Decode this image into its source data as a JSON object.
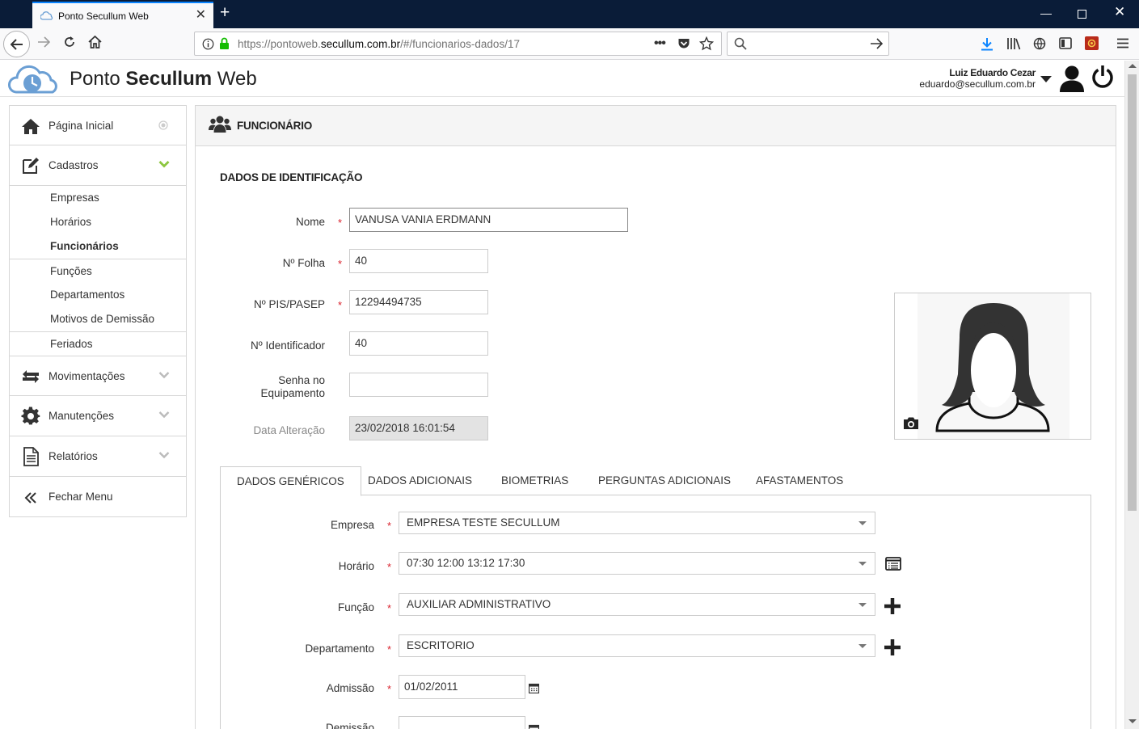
{
  "browser": {
    "tab_title": "Ponto Secullum Web",
    "url_prefix": "https://pontoweb.",
    "url_domain": "secullum.com.br",
    "url_path": "/#/funcionarios-dados/17"
  },
  "app": {
    "title_part1": "Ponto ",
    "title_part2": "Secullum",
    "title_part3": " Web",
    "user_name": "Luiz Eduardo Cezar",
    "user_email": "eduardo@secullum.com.br"
  },
  "sidebar": {
    "home": "Página Inicial",
    "cadastros": "Cadastros",
    "cadastros_items": [
      "Empresas",
      "Horários",
      "Funcionários",
      "Funções",
      "Departamentos",
      "Motivos de Demissão",
      "Feriados"
    ],
    "movimentacoes": "Movimentações",
    "manutencoes": "Manutenções",
    "relatorios": "Relatórios",
    "fechar": "Fechar Menu"
  },
  "panel": {
    "title": "FUNCIONÁRIO",
    "section": "DADOS DE IDENTIFICAÇÃO"
  },
  "form": {
    "nome_label": "Nome",
    "nome_value": "VANUSA VANIA ERDMANN",
    "folha_label": "Nº Folha",
    "folha_value": "40",
    "pis_label": "Nº PIS/PASEP",
    "pis_value": "12294494735",
    "ident_label": "Nº Identificador",
    "ident_value": "40",
    "senha_label_1": "Senha no",
    "senha_label_2": "Equipamento",
    "senha_value": "",
    "data_label": "Data Alteração",
    "data_value": "23/02/2018 16:01:54"
  },
  "tabs": [
    "DADOS GENÉRICOS",
    "DADOS ADICIONAIS",
    "BIOMETRIAS",
    "PERGUNTAS ADICIONAIS",
    "AFASTAMENTOS"
  ],
  "generic": {
    "empresa_label": "Empresa",
    "empresa_value": "EMPRESA TESTE SECULLUM",
    "horario_label": "Horário",
    "horario_value": "07:30 12:00 13:12 17:30",
    "funcao_label": "Função",
    "funcao_value": "AUXILIAR ADMINISTRATIVO",
    "depto_label": "Departamento",
    "depto_value": "ESCRITORIO",
    "admissao_label": "Admissão",
    "admissao_value": "01/02/2011",
    "demissao_label": "Demissão"
  },
  "colors": {
    "required": "#d9232e",
    "chevron_active": "#8cc63f",
    "logo_blue": "#6b9fd4"
  }
}
